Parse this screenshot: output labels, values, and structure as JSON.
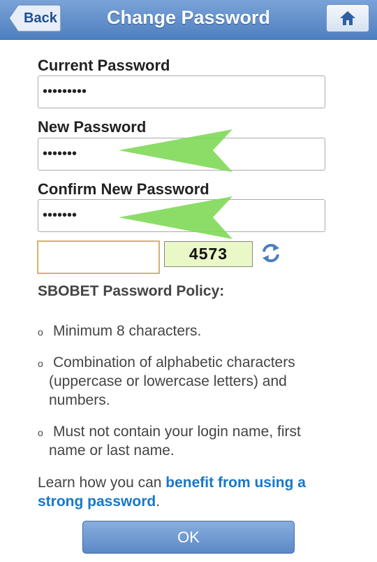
{
  "header": {
    "title": "Change Password",
    "back_label": "Back",
    "home_icon": "home-icon"
  },
  "form": {
    "current_password": {
      "label": "Current Password",
      "value": "•••••••••"
    },
    "new_password": {
      "label": "New Password",
      "value": "•••••••"
    },
    "confirm_password": {
      "label": "Confirm New Password",
      "value": "•••••••"
    },
    "captcha": {
      "input_value": "",
      "code": "4573",
      "refresh_icon": "refresh-icon"
    }
  },
  "policy": {
    "title": "SBOBET Password Policy:",
    "bullet_char": "o",
    "items": [
      "Minimum 8 characters.",
      "Combination of alphabetic characters (uppercase or lowercase letters) and numbers.",
      "Must not contain your login name, first name or last name."
    ]
  },
  "learn": {
    "prefix": "Learn how you can ",
    "link": "benefit from using a strong password",
    "suffix": "."
  },
  "ok_label": "OK",
  "colors": {
    "header": "#5b89c7",
    "link": "#1877c9",
    "arrow": "#7ed957",
    "captcha_bg": "#eaf7c6"
  }
}
